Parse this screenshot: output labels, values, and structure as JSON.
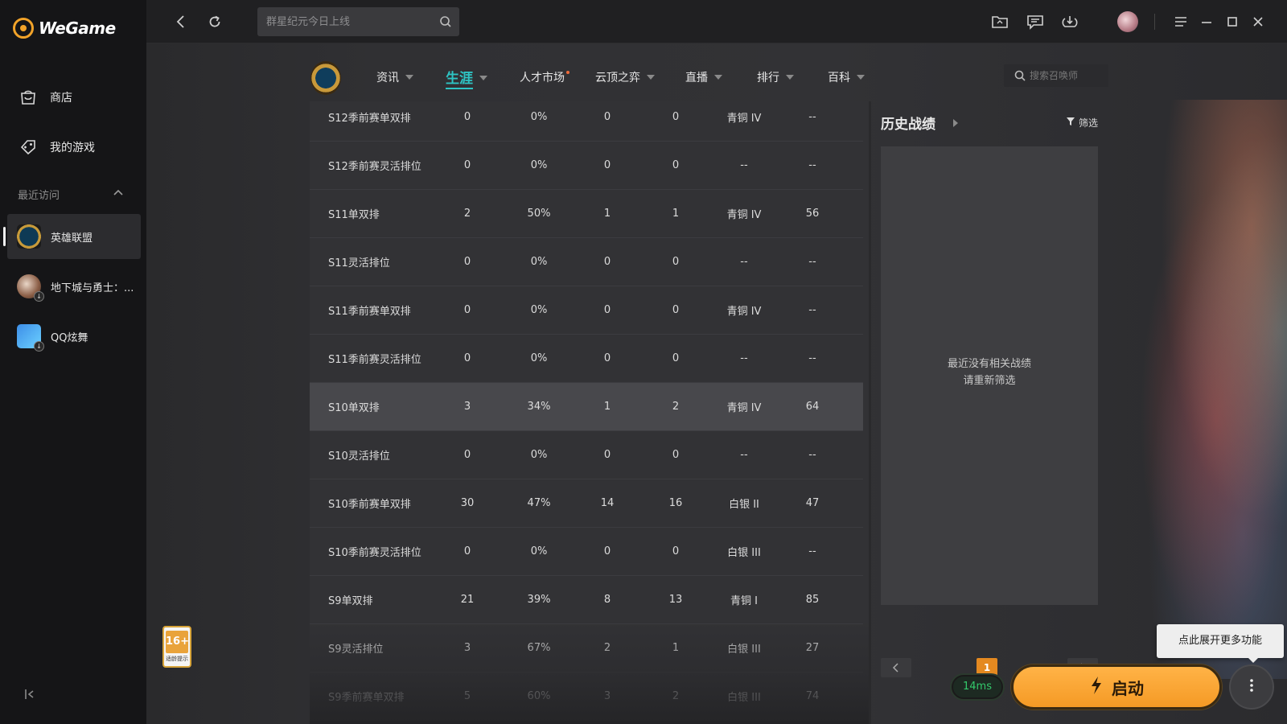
{
  "app": {
    "name": "WeGame"
  },
  "sidebar": {
    "store_label": "商店",
    "mygames_label": "我的游戏",
    "recent_title": "最近访问",
    "games": [
      {
        "label": "英雄联盟",
        "active": true
      },
      {
        "label": "地下城与勇士：...",
        "active": false
      },
      {
        "label": "QQ炫舞",
        "active": false
      }
    ]
  },
  "topbar": {
    "search_placeholder": "群星纪元今日上线"
  },
  "game_nav": {
    "tabs": [
      {
        "label": "资讯",
        "active": false
      },
      {
        "label": "生涯",
        "active": true
      },
      {
        "label": "人才市场",
        "active": false,
        "dot": true
      },
      {
        "label": "云顶之弈",
        "active": false
      },
      {
        "label": "直播",
        "active": false
      },
      {
        "label": "排行",
        "active": false
      },
      {
        "label": "百科",
        "active": false
      }
    ],
    "summoner_search_placeholder": "搜索召唤师"
  },
  "rank_table": {
    "rows": [
      {
        "season": "S12季前赛单双排",
        "games": "0",
        "winrate": "0%",
        "wins": "0",
        "losses": "0",
        "tier": "青铜 IV",
        "points": "--"
      },
      {
        "season": "S12季前赛灵活排位",
        "games": "0",
        "winrate": "0%",
        "wins": "0",
        "losses": "0",
        "tier": "--",
        "points": "--"
      },
      {
        "season": "S11单双排",
        "games": "2",
        "winrate": "50%",
        "wins": "1",
        "losses": "1",
        "tier": "青铜 IV",
        "points": "56"
      },
      {
        "season": "S11灵活排位",
        "games": "0",
        "winrate": "0%",
        "wins": "0",
        "losses": "0",
        "tier": "--",
        "points": "--"
      },
      {
        "season": "S11季前赛单双排",
        "games": "0",
        "winrate": "0%",
        "wins": "0",
        "losses": "0",
        "tier": "青铜 IV",
        "points": "--"
      },
      {
        "season": "S11季前赛灵活排位",
        "games": "0",
        "winrate": "0%",
        "wins": "0",
        "losses": "0",
        "tier": "--",
        "points": "--"
      },
      {
        "season": "S10单双排",
        "games": "3",
        "winrate": "34%",
        "wins": "1",
        "losses": "2",
        "tier": "青铜 IV",
        "points": "64",
        "highlight": true
      },
      {
        "season": "S10灵活排位",
        "games": "0",
        "winrate": "0%",
        "wins": "0",
        "losses": "0",
        "tier": "--",
        "points": "--"
      },
      {
        "season": "S10季前赛单双排",
        "games": "30",
        "winrate": "47%",
        "wins": "14",
        "losses": "16",
        "tier": "白银 II",
        "points": "47"
      },
      {
        "season": "S10季前赛灵活排位",
        "games": "0",
        "winrate": "0%",
        "wins": "0",
        "losses": "0",
        "tier": "白银 III",
        "points": "--"
      },
      {
        "season": "S9单双排",
        "games": "21",
        "winrate": "39%",
        "wins": "8",
        "losses": "13",
        "tier": "青铜 I",
        "points": "85"
      },
      {
        "season": "S9灵活排位",
        "games": "3",
        "winrate": "67%",
        "wins": "2",
        "losses": "1",
        "tier": "白银 III",
        "points": "27"
      },
      {
        "season": "S9季前赛单双排",
        "games": "5",
        "winrate": "60%",
        "wins": "3",
        "losses": "2",
        "tier": "白银 III",
        "points": "74"
      }
    ]
  },
  "history": {
    "title": "历史战绩",
    "filter_label": "筛选",
    "empty_line1": "最近没有相关战绩",
    "empty_line2": "请重新筛选",
    "current_page": "1"
  },
  "age_rating": {
    "number": "16+",
    "label": "适龄提示"
  },
  "footer": {
    "tooltip": "点此展开更多功能",
    "ping": "14ms",
    "launch_label": "启动"
  },
  "colors": {
    "accent_teal": "#2ec4c4",
    "launch_orange": "#f59a25",
    "page_active": "#e48920",
    "ping_green": "#33c96b"
  },
  "icons": [
    "bag-icon",
    "gamepad-icon",
    "chevron-up-icon",
    "collapse-sidebar-icon",
    "back-icon",
    "refresh-icon",
    "search-icon",
    "folder-icon",
    "message-icon",
    "download-icon",
    "menu-icon",
    "minimize-icon",
    "maximize-icon",
    "close-icon",
    "filter-icon",
    "lightning-icon",
    "more-vertical-icon"
  ]
}
